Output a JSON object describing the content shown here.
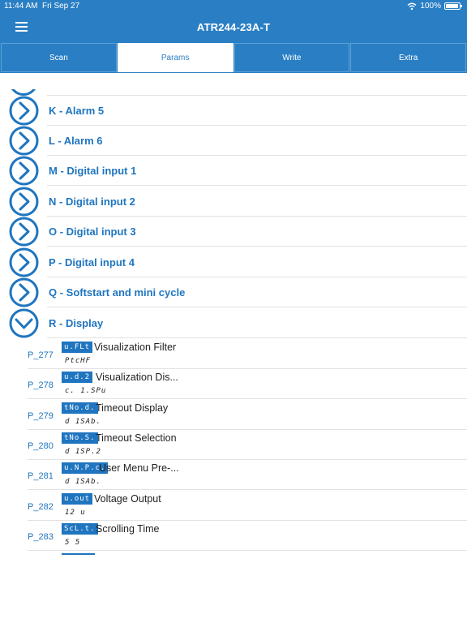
{
  "status_bar": {
    "time": "11:44 AM",
    "date": "Fri Sep 27",
    "battery": "100%"
  },
  "nav": {
    "title": "ATR244-23A-T"
  },
  "tabs": [
    {
      "label": "Scan",
      "active": false
    },
    {
      "label": "Params",
      "active": true
    },
    {
      "label": "Write",
      "active": false
    },
    {
      "label": "Extra",
      "active": false
    }
  ],
  "groups": [
    {
      "label": "K - Alarm 5",
      "expanded": false
    },
    {
      "label": "L - Alarm 6",
      "expanded": false
    },
    {
      "label": "M - Digital input 1",
      "expanded": false
    },
    {
      "label": "N - Digital input 2",
      "expanded": false
    },
    {
      "label": "O - Digital input 3",
      "expanded": false
    },
    {
      "label": "P - Digital input 4",
      "expanded": false
    },
    {
      "label": "Q - Softstart and mini cycle",
      "expanded": false
    },
    {
      "label": "R - Display",
      "expanded": true
    }
  ],
  "params": [
    {
      "id": "P_277",
      "code": "u.FLt",
      "name": "Visualization Filter",
      "value": "PtcHF"
    },
    {
      "id": "P_278",
      "code": "u.d.2",
      "name": "Visualization Dis...",
      "value": "c. 1.SPu"
    },
    {
      "id": "P_279",
      "code": "tNo.d.",
      "name": "Timeout Display",
      "value": "d 1SAb."
    },
    {
      "id": "P_280",
      "code": "tNo.S.",
      "name": "Timeout Selection",
      "value": "d 1SP.2"
    },
    {
      "id": "P_281",
      "code": "u.N.P.c.",
      "name": "User Menu Pre-...",
      "value": "d 1SAb."
    },
    {
      "id": "P_282",
      "code": "u.out",
      "name": "Voltage Output",
      "value": "12  u"
    },
    {
      "id": "P_283",
      "code": "ScL.t.",
      "name": "Scrolling Time",
      "value": "5  5"
    }
  ],
  "colors": {
    "brand": "#2a7fc4",
    "accent": "#1f75bf",
    "separator": "#e2e2e2"
  },
  "icons": {
    "menu": "hamburger-menu-icon",
    "wifi": "wifi-icon",
    "battery": "battery-icon",
    "collapsed": "chevron-right-circle-icon",
    "expanded": "chevron-down-circle-icon"
  }
}
